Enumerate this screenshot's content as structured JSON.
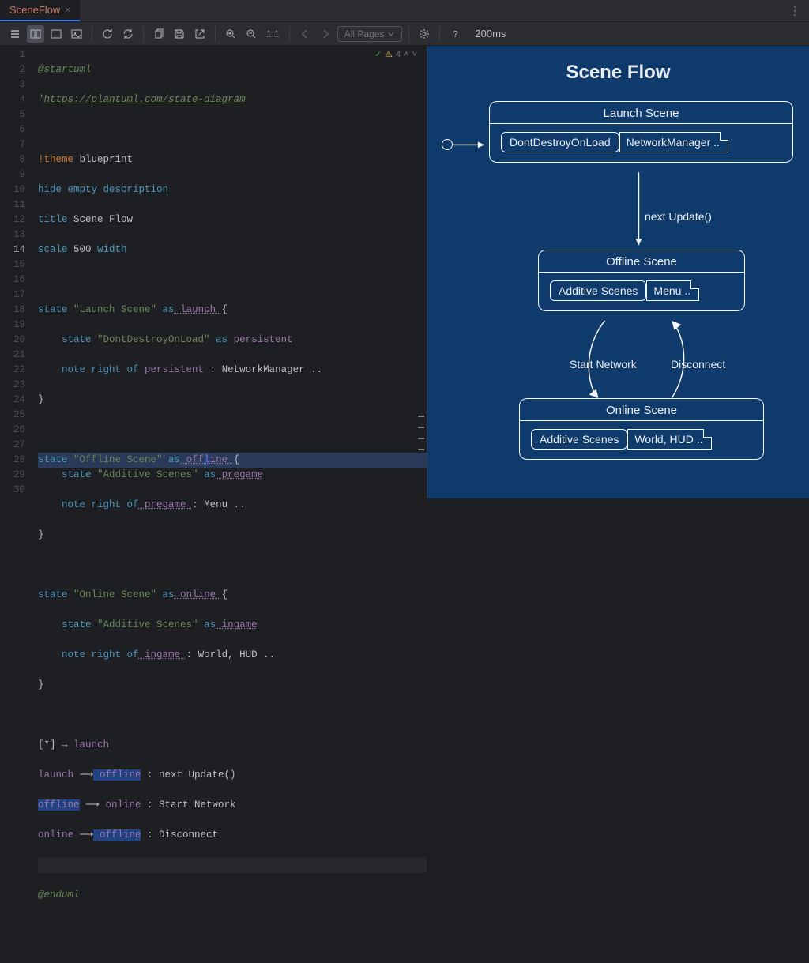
{
  "tab": {
    "title": "SceneFlow",
    "close": "×"
  },
  "toolbar": {
    "ratio": "1:1",
    "pages_label": "All Pages",
    "status_time": "200ms"
  },
  "hints": {
    "count": "4"
  },
  "gutter": [
    "1",
    "2",
    "3",
    "4",
    "5",
    "6",
    "7",
    "8",
    "9",
    "10",
    "11",
    "12",
    "13",
    "14",
    "15",
    "16",
    "17",
    "18",
    "19",
    "20",
    "21",
    "22",
    "23",
    "24",
    "25",
    "26",
    "27",
    "28",
    "29",
    "30"
  ],
  "code": {
    "l1_startuml": "@startuml",
    "l2_cmt_pre": "'",
    "l2_link": "https://plantuml.com/state-diagram",
    "l4_theme": "!theme",
    "l4_theme_v": " blueprint",
    "l5_hide": "hide",
    "l5_empty": " empty ",
    "l5_desc": "description",
    "l6_title": "title",
    "l6_title_v": " Scene Flow",
    "l7_scale": "scale",
    "l7_scale_v": " 500 ",
    "l7_width": "width",
    "l9_state": "state",
    "l9_str": " \"Launch Scene\" ",
    "l9_as": "as",
    "l9_id": " launch ",
    "l9_brace": "{",
    "l10_state": "state",
    "l10_str": " \"DontDestroyOnLoad\" ",
    "l10_as": "as",
    "l10_id": " persistent",
    "l11_note": "note right of",
    "l11_id": " persistent ",
    "l11_rest": ": NetworkManager ..",
    "l12_brace": "}",
    "l14_state": "state",
    "l14_str": " \"Offline Scene\" ",
    "l14_as": "as",
    "l14_id_pre": " off",
    "l14_id_cursor": "l",
    "l14_id_post": "ine ",
    "l14_brace": "{",
    "l15_state": "state",
    "l15_str": " \"Additive Scenes\" ",
    "l15_as": "as",
    "l15_id": " pregame",
    "l16_note": "note right of",
    "l16_id": " pregame ",
    "l16_rest": ": Menu ..",
    "l17_brace": "}",
    "l19_state": "state",
    "l19_str": " \"Online Scene\" ",
    "l19_as": "as",
    "l19_id": " online ",
    "l19_brace": "{",
    "l20_state": "state",
    "l20_str": " \"Additive Scenes\" ",
    "l20_as": "as",
    "l20_id": " ingame",
    "l21_note": "note right of",
    "l21_id": " ingame ",
    "l21_rest": ": World, HUD ..",
    "l22_brace": "}",
    "l24_star": "[*] ",
    "l24_arrow": "→",
    "l24_target": " launch",
    "l25_src": "launch ",
    "l25_arrow": "⟶",
    "l25_tgt": " offline",
    "l25_lbl": " : next Update()",
    "l26_src": "offline",
    "l26_arrow": " ⟶ ",
    "l26_tgt": "online",
    "l26_lbl": " : Start Network",
    "l27_src": "online ",
    "l27_arrow": "⟶",
    "l27_tgt": " offline",
    "l27_lbl": " : Disconnect",
    "l29_enduml": "@enduml"
  },
  "diagram": {
    "title": "Scene Flow",
    "launch": {
      "title": "Launch Scene",
      "inner": "DontDestroyOnLoad",
      "note": "NetworkManager .."
    },
    "offline": {
      "title": "Offline Scene",
      "inner": "Additive Scenes",
      "note": "Menu .."
    },
    "online": {
      "title": "Online Scene",
      "inner": "Additive Scenes",
      "note": "World, HUD .."
    },
    "edge1": "next Update()",
    "edge2": "Start Network",
    "edge3": "Disconnect"
  }
}
